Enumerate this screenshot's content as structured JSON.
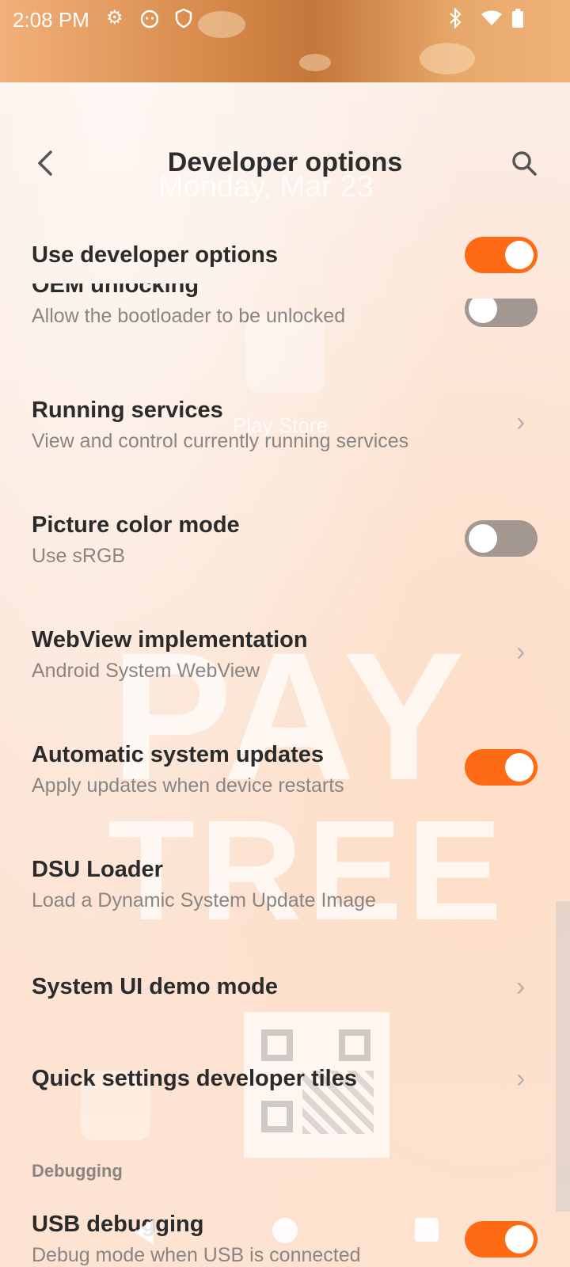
{
  "status_bar": {
    "time": "2:08 PM",
    "icons": [
      "gear-icon",
      "cat-face-icon",
      "shield-icon",
      "bluetooth-icon",
      "wifi-icon",
      "battery-icon"
    ]
  },
  "toolbar": {
    "title": "Developer options",
    "back_icon": "chevron-left-icon",
    "search_icon": "search-icon"
  },
  "background": {
    "date_text": "Monday, Mar 23",
    "app_label": "Play Store",
    "watermark_line1": "PAY",
    "watermark_line2": "TREE"
  },
  "settings": [
    {
      "title": "Use developer options",
      "subtitle": "",
      "control": "toggle",
      "on": true
    },
    {
      "title": "OEM unlocking",
      "subtitle": "Allow the bootloader to be unlocked",
      "control": "toggle",
      "on": false
    },
    {
      "title": "Running services",
      "subtitle": "View and control currently running services",
      "control": "chevron"
    },
    {
      "title": "Picture color mode",
      "subtitle": "Use sRGB",
      "control": "toggle",
      "on": false
    },
    {
      "title": "WebView implementation",
      "subtitle": "Android System WebView",
      "control": "chevron"
    },
    {
      "title": "Automatic system updates",
      "subtitle": "Apply updates when device restarts",
      "control": "toggle",
      "on": true
    },
    {
      "title": "DSU Loader",
      "subtitle": "Load a Dynamic System Update Image",
      "control": "none"
    },
    {
      "title": "System UI demo mode",
      "subtitle": "",
      "control": "chevron"
    },
    {
      "title": "Quick settings developer tiles",
      "subtitle": "",
      "control": "chevron"
    }
  ],
  "section_header": "Debugging",
  "debug_settings": [
    {
      "title": "USB debugging",
      "subtitle": "Debug mode when USB is connected",
      "control": "toggle",
      "on": true
    }
  ],
  "colors": {
    "accent": "#ff6a14",
    "toggle_off": "#a39791"
  }
}
